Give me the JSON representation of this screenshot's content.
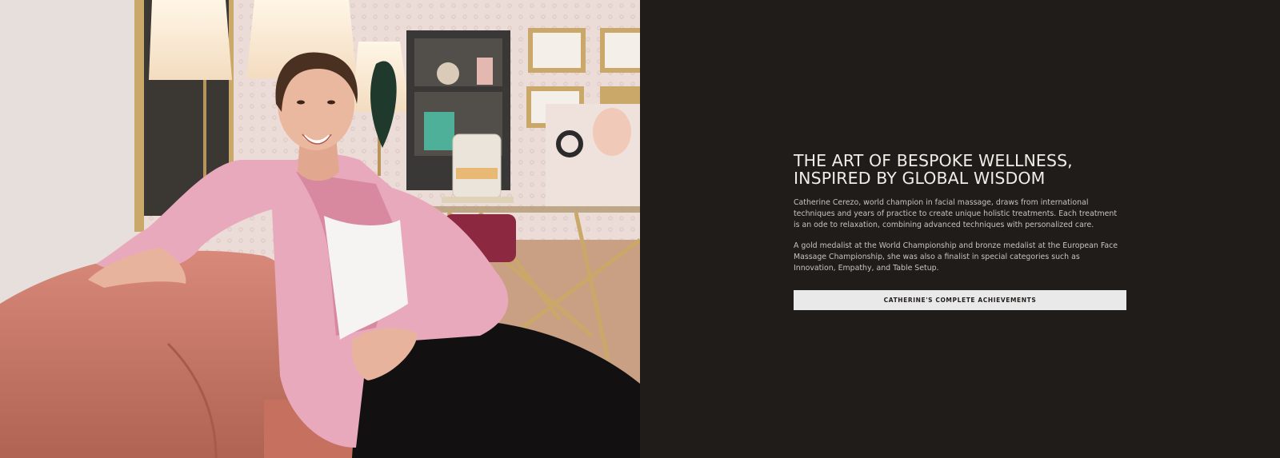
{
  "intro": {
    "title": "THE ART OF BESPOKE WELLNESS, INSPIRED BY GLOBAL WISDOM",
    "paragraphs": [
      "Catherine Cerezo, world champion in facial massage, draws from international techniques and years of practice to create unique holistic treatments. Each treatment is an ode to relaxation, combining advanced techniques with personalized care.",
      "A gold medalist at the World Championship and bronze medalist at the European Face Massage Championship, she was also a finalist in special categories such as Innovation, Empathy, and Table Setup."
    ],
    "cta_label": "CATHERINE'S COMPLETE ACHIEVEMENTS"
  },
  "colors": {
    "panel_background": "#201c1a",
    "heading_text": "#f1ece6",
    "body_text": "#c9c2bc",
    "button_background": "#e9e9e9",
    "blazer_pink": "#e9a9bd",
    "sofa_terracotta": "#c97864"
  }
}
